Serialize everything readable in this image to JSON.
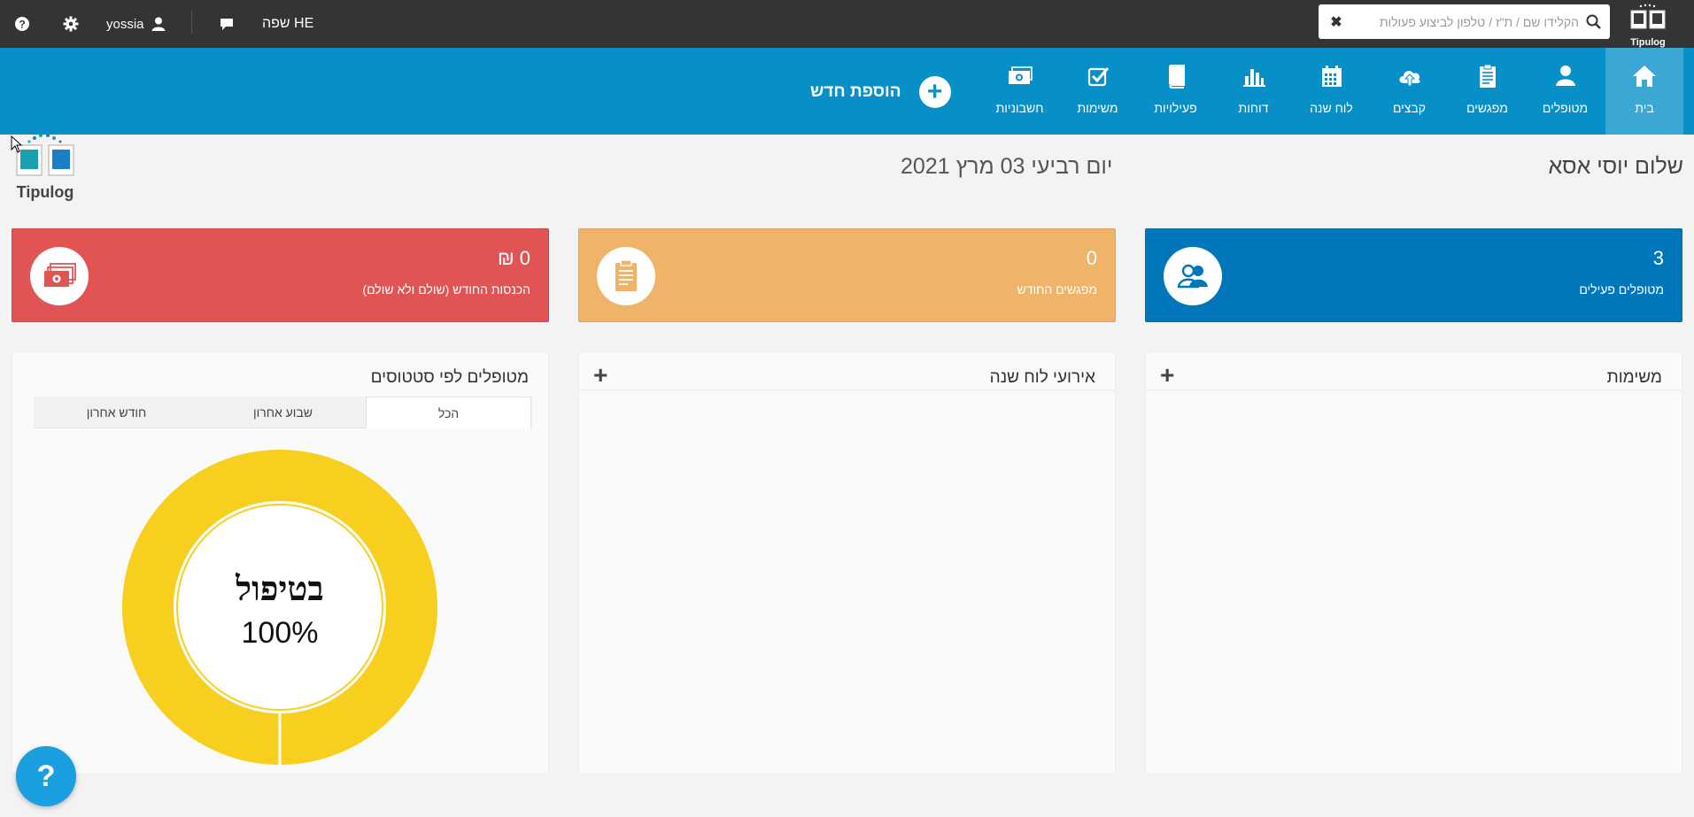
{
  "topbar": {
    "language_label": "שפה HE",
    "username": "yossia",
    "search_placeholder": "הקלידו שם / ת\"ז / טלפון לביצוע פעולות",
    "logo_text": "Tipulog"
  },
  "nav": {
    "items": [
      {
        "label": "בית",
        "icon": "home-icon",
        "active": true
      },
      {
        "label": "מטופלים",
        "icon": "user-icon"
      },
      {
        "label": "מפגשים",
        "icon": "clipboard-icon"
      },
      {
        "label": "קבצים",
        "icon": "cloud-upload-icon"
      },
      {
        "label": "לוח שנה",
        "icon": "calendar-icon"
      },
      {
        "label": "דוחות",
        "icon": "bar-chart-icon"
      },
      {
        "label": "פעילויות",
        "icon": "book-icon"
      },
      {
        "label": "משימות",
        "icon": "checklist-icon"
      },
      {
        "label": "חשבוניות",
        "icon": "money-icon"
      }
    ],
    "add_new_label": "הוספת חדש"
  },
  "greeting": "שלום יוסי אסא",
  "date": "יום רביעי 03 מרץ 2021",
  "logo_text": "Tipulog",
  "cards": {
    "patients": {
      "value": "3",
      "label": "מטופלים פעילים",
      "color": "#0077bb"
    },
    "meetings": {
      "value": "0",
      "label": "מפגשים החודש",
      "color": "#efb36a"
    },
    "income": {
      "value": "0 ₪",
      "label": "הכנסות החודש (שולם ולא שולם)",
      "color": "#e05454"
    }
  },
  "panels": {
    "tasks": {
      "title": "משימות",
      "plus": "+"
    },
    "calendar": {
      "title": "אירועי לוח שנה",
      "plus": "+"
    },
    "status": {
      "title": "מטופלים לפי סטטוסים",
      "tabs": [
        "הכל",
        "שבוע אחרון",
        "חודש אחרון"
      ],
      "active_tab": "הכל"
    }
  },
  "chart_data": {
    "type": "pie",
    "categories": [
      "בטיפול"
    ],
    "values": [
      100
    ],
    "center_label": "בטיפול",
    "center_value": "100%",
    "colors": [
      "#f8cf1f"
    ]
  },
  "help_label": "?"
}
